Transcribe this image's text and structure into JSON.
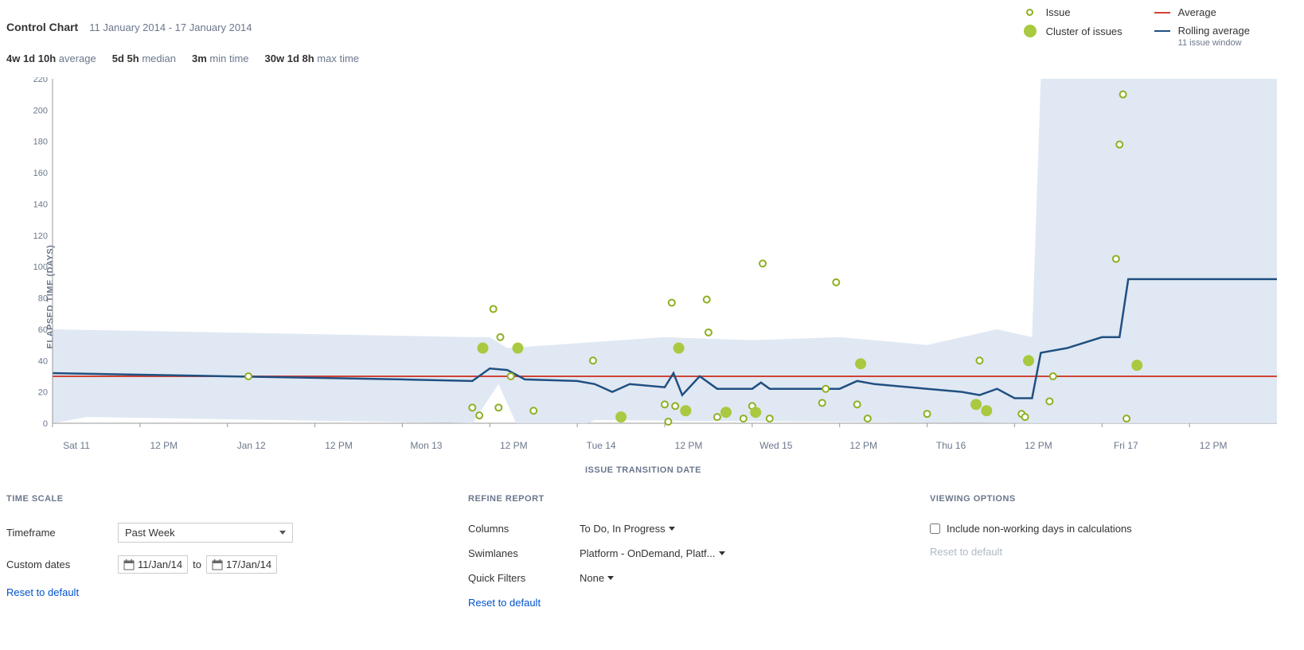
{
  "header": {
    "title": "Control Chart",
    "date_range": "11 January 2014 - 17 January 2014"
  },
  "legend": {
    "issue": "Issue",
    "cluster": "Cluster of issues",
    "average": "Average",
    "rolling": "Rolling average",
    "rolling_sub": "11 issue window"
  },
  "stats": {
    "average": {
      "value": "4w 1d 10h",
      "label": "average"
    },
    "median": {
      "value": "5d 5h",
      "label": "median"
    },
    "min": {
      "value": "3m",
      "label": "min time"
    },
    "max": {
      "value": "30w 1d 8h",
      "label": "max time"
    }
  },
  "axes": {
    "y_label": "ELAPSED TIME (DAYS)",
    "x_label": "ISSUE TRANSITION DATE"
  },
  "controls": {
    "time_scale": {
      "header": "TIME SCALE",
      "timeframe_label": "Timeframe",
      "timeframe_value": "Past Week",
      "custom_label": "Custom dates",
      "from": "11/Jan/14",
      "to_sep": "to",
      "to": "17/Jan/14",
      "reset": "Reset to default"
    },
    "refine": {
      "header": "REFINE REPORT",
      "columns_label": "Columns",
      "columns_value": "To Do, In Progress",
      "swimlanes_label": "Swimlanes",
      "swimlanes_value": "Platform - OnDemand, Platf...",
      "filters_label": "Quick Filters",
      "filters_value": "None",
      "reset": "Reset to default"
    },
    "viewing": {
      "header": "VIEWING OPTIONS",
      "include_nonworking": "Include non-working days in calculations",
      "reset": "Reset to default"
    }
  },
  "chart_data": {
    "type": "scatter+line",
    "title": "Control Chart",
    "xlabel": "ISSUE TRANSITION DATE",
    "ylabel": "ELAPSED TIME (DAYS)",
    "ylim": [
      0,
      220
    ],
    "y_ticks": [
      0,
      20,
      40,
      60,
      80,
      100,
      120,
      140,
      160,
      180,
      200,
      220
    ],
    "x_ticks": [
      "Sat 11",
      "12 PM",
      "Jan 12",
      "12 PM",
      "Mon 13",
      "12 PM",
      "Tue 14",
      "12 PM",
      "Wed 15",
      "12 PM",
      "Thu 16",
      "12 PM",
      "Fri 17",
      "12 PM"
    ],
    "average": 30,
    "rolling_average": [
      {
        "x": 0.0,
        "y": 32
      },
      {
        "x": 0.5,
        "y": 31
      },
      {
        "x": 1.0,
        "y": 30
      },
      {
        "x": 1.5,
        "y": 29
      },
      {
        "x": 2.0,
        "y": 28
      },
      {
        "x": 2.4,
        "y": 27
      },
      {
        "x": 2.5,
        "y": 35
      },
      {
        "x": 2.6,
        "y": 34
      },
      {
        "x": 2.7,
        "y": 28
      },
      {
        "x": 3.0,
        "y": 27
      },
      {
        "x": 3.1,
        "y": 25
      },
      {
        "x": 3.2,
        "y": 20
      },
      {
        "x": 3.3,
        "y": 25
      },
      {
        "x": 3.5,
        "y": 23
      },
      {
        "x": 3.55,
        "y": 32
      },
      {
        "x": 3.6,
        "y": 18
      },
      {
        "x": 3.7,
        "y": 30
      },
      {
        "x": 3.8,
        "y": 22
      },
      {
        "x": 4.0,
        "y": 22
      },
      {
        "x": 4.05,
        "y": 26
      },
      {
        "x": 4.1,
        "y": 22
      },
      {
        "x": 4.5,
        "y": 22
      },
      {
        "x": 4.6,
        "y": 27
      },
      {
        "x": 4.7,
        "y": 25
      },
      {
        "x": 5.0,
        "y": 22
      },
      {
        "x": 5.2,
        "y": 20
      },
      {
        "x": 5.3,
        "y": 18
      },
      {
        "x": 5.4,
        "y": 22
      },
      {
        "x": 5.5,
        "y": 16
      },
      {
        "x": 5.6,
        "y": 16
      },
      {
        "x": 5.65,
        "y": 45
      },
      {
        "x": 5.8,
        "y": 48
      },
      {
        "x": 6.0,
        "y": 55
      },
      {
        "x": 6.1,
        "y": 55
      },
      {
        "x": 6.15,
        "y": 92
      },
      {
        "x": 7.0,
        "y": 92
      }
    ],
    "band_upper": [
      {
        "x": 0.0,
        "y": 60
      },
      {
        "x": 2.4,
        "y": 55
      },
      {
        "x": 2.5,
        "y": 55
      },
      {
        "x": 2.6,
        "y": 48
      },
      {
        "x": 3.5,
        "y": 55
      },
      {
        "x": 4.0,
        "y": 53
      },
      {
        "x": 4.5,
        "y": 55
      },
      {
        "x": 5.0,
        "y": 50
      },
      {
        "x": 5.4,
        "y": 60
      },
      {
        "x": 5.6,
        "y": 55
      },
      {
        "x": 5.65,
        "y": 220
      },
      {
        "x": 7.0,
        "y": 220
      }
    ],
    "band_lower": [
      {
        "x": 0.0,
        "y": 0
      },
      {
        "x": 0.2,
        "y": 4
      },
      {
        "x": 2.4,
        "y": 0
      },
      {
        "x": 2.55,
        "y": 25
      },
      {
        "x": 2.65,
        "y": 0
      },
      {
        "x": 3.06,
        "y": 0
      },
      {
        "x": 3.1,
        "y": 2
      },
      {
        "x": 5.6,
        "y": 0
      },
      {
        "x": 5.65,
        "y": 0
      },
      {
        "x": 7.0,
        "y": 0
      }
    ],
    "issues": [
      {
        "x": 1.12,
        "y": 30,
        "cluster": false
      },
      {
        "x": 2.4,
        "y": 10,
        "cluster": false
      },
      {
        "x": 2.44,
        "y": 5,
        "cluster": false
      },
      {
        "x": 2.46,
        "y": 48,
        "cluster": true
      },
      {
        "x": 2.52,
        "y": 73,
        "cluster": false
      },
      {
        "x": 2.55,
        "y": 10,
        "cluster": false
      },
      {
        "x": 2.56,
        "y": 55,
        "cluster": false
      },
      {
        "x": 2.62,
        "y": 30,
        "cluster": false
      },
      {
        "x": 2.66,
        "y": 48,
        "cluster": true
      },
      {
        "x": 2.75,
        "y": 8,
        "cluster": false
      },
      {
        "x": 3.09,
        "y": 40,
        "cluster": false
      },
      {
        "x": 3.25,
        "y": 4,
        "cluster": true
      },
      {
        "x": 3.5,
        "y": 12,
        "cluster": false
      },
      {
        "x": 3.52,
        "y": 1,
        "cluster": false
      },
      {
        "x": 3.54,
        "y": 77,
        "cluster": false
      },
      {
        "x": 3.56,
        "y": 11,
        "cluster": false
      },
      {
        "x": 3.58,
        "y": 48,
        "cluster": true
      },
      {
        "x": 3.62,
        "y": 8,
        "cluster": true
      },
      {
        "x": 3.74,
        "y": 79,
        "cluster": false
      },
      {
        "x": 3.75,
        "y": 58,
        "cluster": false
      },
      {
        "x": 3.8,
        "y": 4,
        "cluster": false
      },
      {
        "x": 3.85,
        "y": 7,
        "cluster": true
      },
      {
        "x": 3.95,
        "y": 3,
        "cluster": false
      },
      {
        "x": 4.0,
        "y": 11,
        "cluster": false
      },
      {
        "x": 4.02,
        "y": 7,
        "cluster": true
      },
      {
        "x": 4.06,
        "y": 102,
        "cluster": false
      },
      {
        "x": 4.1,
        "y": 3,
        "cluster": false
      },
      {
        "x": 4.4,
        "y": 13,
        "cluster": false
      },
      {
        "x": 4.42,
        "y": 22,
        "cluster": false
      },
      {
        "x": 4.48,
        "y": 90,
        "cluster": false
      },
      {
        "x": 4.6,
        "y": 12,
        "cluster": false
      },
      {
        "x": 4.62,
        "y": 38,
        "cluster": true
      },
      {
        "x": 4.66,
        "y": 3,
        "cluster": false
      },
      {
        "x": 5.0,
        "y": 6,
        "cluster": false
      },
      {
        "x": 5.28,
        "y": 12,
        "cluster": true
      },
      {
        "x": 5.3,
        "y": 40,
        "cluster": false
      },
      {
        "x": 5.34,
        "y": 8,
        "cluster": true
      },
      {
        "x": 5.54,
        "y": 6,
        "cluster": false
      },
      {
        "x": 5.56,
        "y": 4,
        "cluster": false
      },
      {
        "x": 5.58,
        "y": 40,
        "cluster": true
      },
      {
        "x": 5.7,
        "y": 14,
        "cluster": false
      },
      {
        "x": 5.72,
        "y": 30,
        "cluster": false
      },
      {
        "x": 6.08,
        "y": 105,
        "cluster": false
      },
      {
        "x": 6.1,
        "y": 178,
        "cluster": false
      },
      {
        "x": 6.12,
        "y": 210,
        "cluster": false
      },
      {
        "x": 6.14,
        "y": 3,
        "cluster": false
      },
      {
        "x": 6.2,
        "y": 37,
        "cluster": true
      }
    ]
  }
}
